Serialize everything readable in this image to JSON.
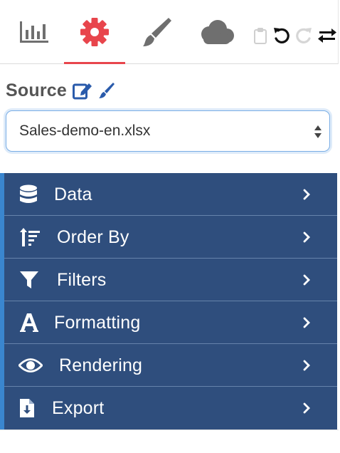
{
  "tabs": [
    {
      "icon": "bar-chart-icon",
      "label": ""
    },
    {
      "icon": "gear-icon",
      "label": "",
      "active": true
    },
    {
      "icon": "paint-brush-icon",
      "label": ""
    },
    {
      "icon": "cloud-icon",
      "label": ""
    }
  ],
  "toolbar": {
    "icons": [
      "clipboard-icon",
      "undo-icon",
      "redo-icon",
      "swap-icon"
    ]
  },
  "source": {
    "title": "Source",
    "edit_icon": "edit-icon",
    "brush_icon": "paint-brush-icon"
  },
  "file_select": {
    "value": "Sales-demo-en.xlsx"
  },
  "menu": {
    "items": [
      {
        "label": "Data",
        "icon": "database-icon"
      },
      {
        "label": "Order By",
        "icon": "sort-icon"
      },
      {
        "label": "Filters",
        "icon": "filter-icon"
      },
      {
        "label": "Formatting",
        "icon": "font-icon"
      },
      {
        "label": "Rendering",
        "icon": "eye-icon"
      },
      {
        "label": "Export",
        "icon": "file-export-icon"
      }
    ]
  },
  "colors": {
    "accent": "#e8454c",
    "menu_bg": "#2f4e7d",
    "menu_border": "#3a86cf",
    "focus": "#7aaee6",
    "icon_gray": "#6f6f6f",
    "link_blue": "#2a5bab"
  }
}
